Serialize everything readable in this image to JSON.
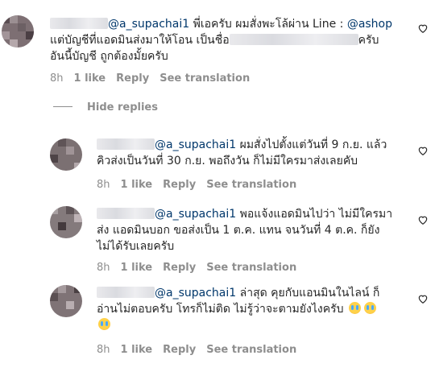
{
  "comments": [
    {
      "mention": "@a_supachai1",
      "text_first": " พี่เอครับ ผมสั่งพะโล้ผ่าน Line : ",
      "mention2": "@ashop",
      "line2_start": "แต่บัญชีที่แอดมินส่งมาให้โอน เป็นชื่อ",
      "line2_end": "ครับ",
      "line3": "อันนี้บัญชี ถูกต้องมั้ยครับ",
      "time": "8h",
      "likes": "1 like",
      "reply": "Reply",
      "translate": "See translation"
    },
    {
      "mention": "@a_supachai1",
      "line1": " ผมสั่งไปตั้งแต่วันที่ 9 ก.ย. แล้ว",
      "line2": "คิวส่งเป็นวันที่ 30 ก.ย. พอถึงวัน ก็ไม่มีใครมาส่งเลยคับ",
      "time": "8h",
      "likes": "1 like",
      "reply": "Reply",
      "translate": "See translation"
    },
    {
      "mention": "@a_supachai1",
      "line1": " พอแจ้งแอดมินไปว่า ไม่มีใครมา",
      "line2": "ส่ง แอดมินบอก ขอส่งเป็น 1 ต.ค. แทน จนวันที่ 4 ต.ค. ก็ยัง",
      "line3": "ไม่ได้รับเลยครับ",
      "time": "8h",
      "likes": "1 like",
      "reply": "Reply",
      "translate": "See translation"
    },
    {
      "mention": "@a_supachai1",
      "line1": " ล่าสุด คุยกับแอนมินในไลน์ ก็",
      "line2": "อ่านไม่ตอบครับ โทรก็ไม่ติด ไม่รู้ว่าจะตามยังไงครับ",
      "time": "8h",
      "likes": "1 like",
      "reply": "Reply",
      "translate": "See translation"
    }
  ],
  "hide_replies": "Hide replies",
  "icons": {
    "like": "heart-outline-icon",
    "emoji": "crying-face-emoji"
  },
  "colors": {
    "mention": "#00376b",
    "meta": "#8e8e8e",
    "text": "#262626"
  }
}
